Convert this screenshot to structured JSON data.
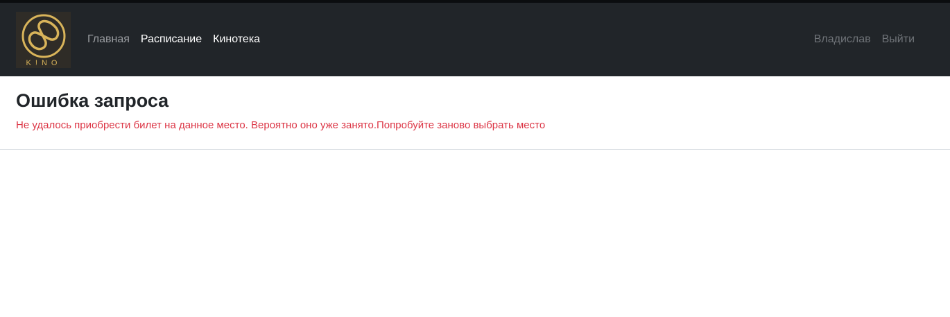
{
  "navbar": {
    "logo_text": "K!NO",
    "links": [
      {
        "label": "Главная"
      },
      {
        "label": "Расписание"
      },
      {
        "label": "Кинотека"
      }
    ],
    "user_name": "Владислав",
    "logout_label": "Выйти"
  },
  "main": {
    "title": "Ошибка запроса",
    "error_message": "Не удалось приобрести билет на данное место. Вероятно оно уже занято.Попробуйте заново выбрать место"
  },
  "colors": {
    "navbar_bg": "#212529",
    "logo_gold": "#d9b45a",
    "error_red": "#dc3545"
  },
  "icons": {
    "logo": "infinity-logo-icon"
  }
}
